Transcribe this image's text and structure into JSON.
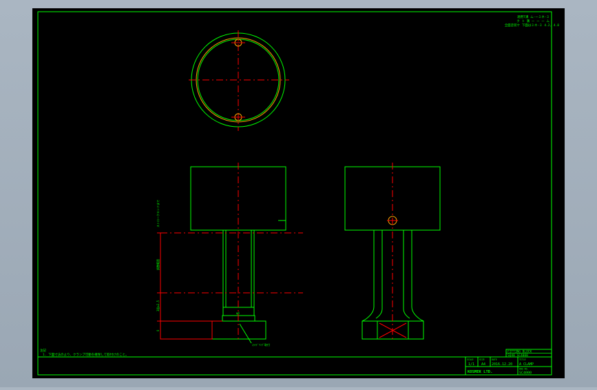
{
  "notes": {
    "title": "注記",
    "line1": "1. 下図寸法のより、クランプ可動を確保して取付けのこと。"
  },
  "spec_block": {
    "line1": "適用T溝  ム-ーミネ-ミ",
    "line2": "ク ト 溝 ー ー ー ム",
    "line3": "全面塗装ケ 下面はミネ-ミ 4.2, 4.8"
  },
  "dimensions": {
    "total": "ストロークエンドまで",
    "mid": "調整範囲",
    "low": "3段±2.5",
    "base_zero": "0",
    "callout": "ｽﾗｲﾄﾞﾘﾝｸﾞ取付",
    "small": "φ4"
  },
  "title_block": {
    "name_r1": "FITTING BLOCK",
    "name_r2": "SQ40 SC4000",
    "scale_hdr": "SCALE",
    "scale": "1/1",
    "size_hdr": "SIZE",
    "size": "A4",
    "date_hdr": "DATE",
    "date": "2016.12.20",
    "title_hdr": "TITLE",
    "title": "A CLAMP",
    "company": "KOSMEK LTD.",
    "dwg_hdr": "DWG NO.",
    "dwg_no": "SC4000"
  },
  "colors": {
    "background": "#000000",
    "border": "#00ff00",
    "centerline": "#ff0000",
    "hidden": "#ffa500",
    "frame": "#aab6c2"
  }
}
